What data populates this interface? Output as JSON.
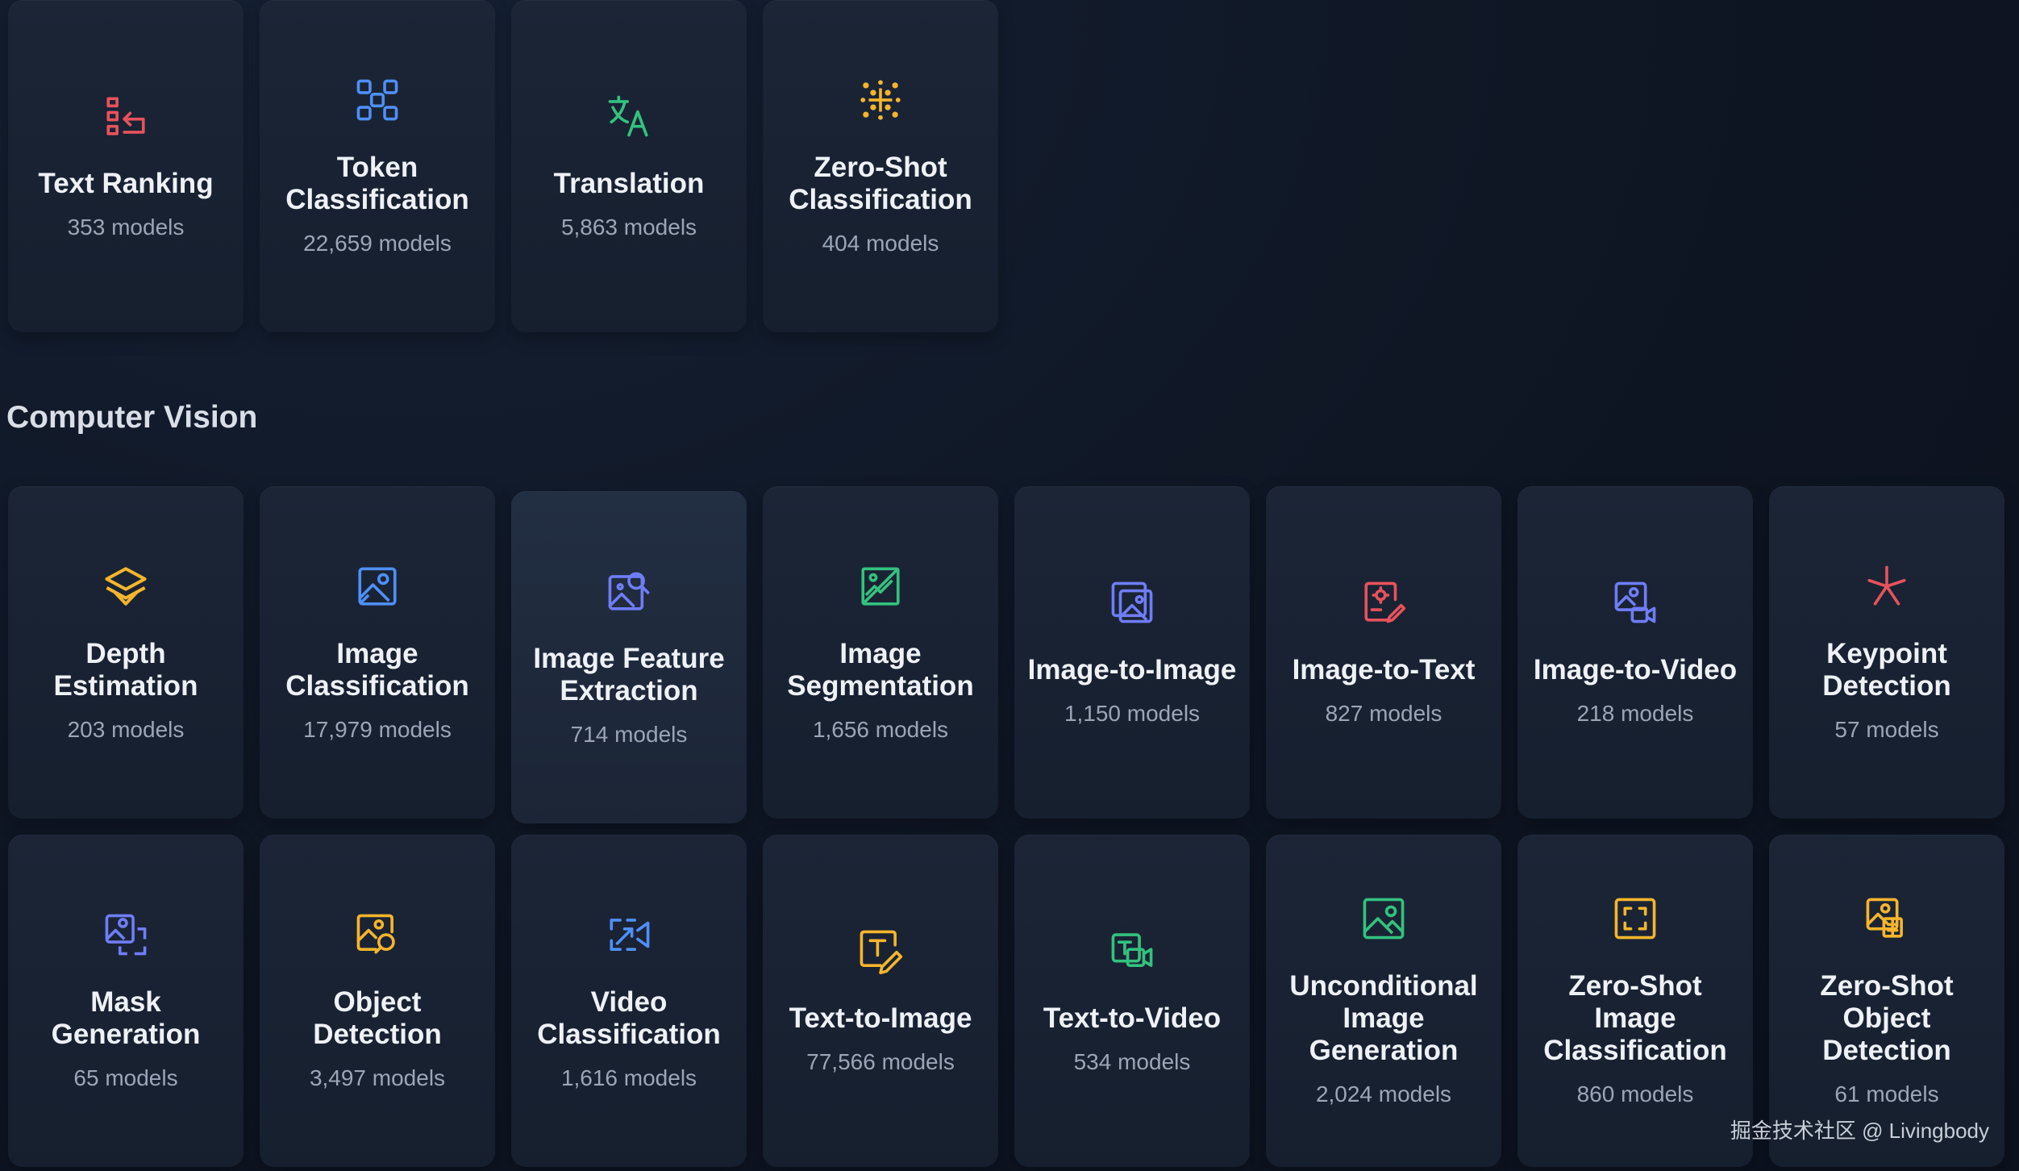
{
  "nlp_cards": [
    {
      "title": "Text Ranking",
      "count": "353 models",
      "icon": "text-ranking-icon",
      "color": "#e8525c"
    },
    {
      "title": "Token Classification",
      "count": "22,659 models",
      "icon": "token-classification-icon",
      "color": "#4f8ff7"
    },
    {
      "title": "Translation",
      "count": "5,863 models",
      "icon": "translation-icon",
      "color": "#33c27f"
    },
    {
      "title": "Zero-Shot Classification",
      "count": "404 models",
      "icon": "zero-shot-classification-icon",
      "color": "#f5b52c"
    }
  ],
  "section": {
    "title": "Computer Vision"
  },
  "cv_cards": [
    {
      "title": "Depth Estimation",
      "count": "203 models",
      "icon": "depth-estimation-icon",
      "color": "#f5b52c"
    },
    {
      "title": "Image Classification",
      "count": "17,979 models",
      "icon": "image-classification-icon",
      "color": "#4f8ff7"
    },
    {
      "title": "Image Feature Extraction",
      "count": "714 models",
      "icon": "image-feature-extraction-icon",
      "color": "#6f7df7"
    },
    {
      "title": "Image Segmentation",
      "count": "1,656 models",
      "icon": "image-segmentation-icon",
      "color": "#33c27f"
    },
    {
      "title": "Image-to-Image",
      "count": "1,150 models",
      "icon": "image-to-image-icon",
      "color": "#6f7df7"
    },
    {
      "title": "Image-to-Text",
      "count": "827 models",
      "icon": "image-to-text-icon",
      "color": "#e8525c"
    },
    {
      "title": "Image-to-Video",
      "count": "218 models",
      "icon": "image-to-video-icon",
      "color": "#6f7df7"
    },
    {
      "title": "Keypoint Detection",
      "count": "57 models",
      "icon": "keypoint-detection-icon",
      "color": "#e8525c"
    },
    {
      "title": "Mask Generation",
      "count": "65 models",
      "icon": "mask-generation-icon",
      "color": "#6f7df7"
    },
    {
      "title": "Object Detection",
      "count": "3,497 models",
      "icon": "object-detection-icon",
      "color": "#f5b52c"
    },
    {
      "title": "Video Classification",
      "count": "1,616 models",
      "icon": "video-classification-icon",
      "color": "#4f8ff7"
    },
    {
      "title": "Text-to-Image",
      "count": "77,566 models",
      "icon": "text-to-image-icon",
      "color": "#f5b52c"
    },
    {
      "title": "Text-to-Video",
      "count": "534 models",
      "icon": "text-to-video-icon",
      "color": "#33c27f"
    },
    {
      "title": "Unconditional Image Generation",
      "count": "2,024 models",
      "icon": "unconditional-image-generation-icon",
      "color": "#33c27f"
    },
    {
      "title": "Zero-Shot Image Classification",
      "count": "860 models",
      "icon": "zero-shot-image-classification-icon",
      "color": "#f5b52c"
    },
    {
      "title": "Zero-Shot Object Detection",
      "count": "61 models",
      "icon": "zero-shot-object-detection-icon",
      "color": "#f5b52c"
    }
  ],
  "watermark": "掘金技术社区 @ Livingbody"
}
